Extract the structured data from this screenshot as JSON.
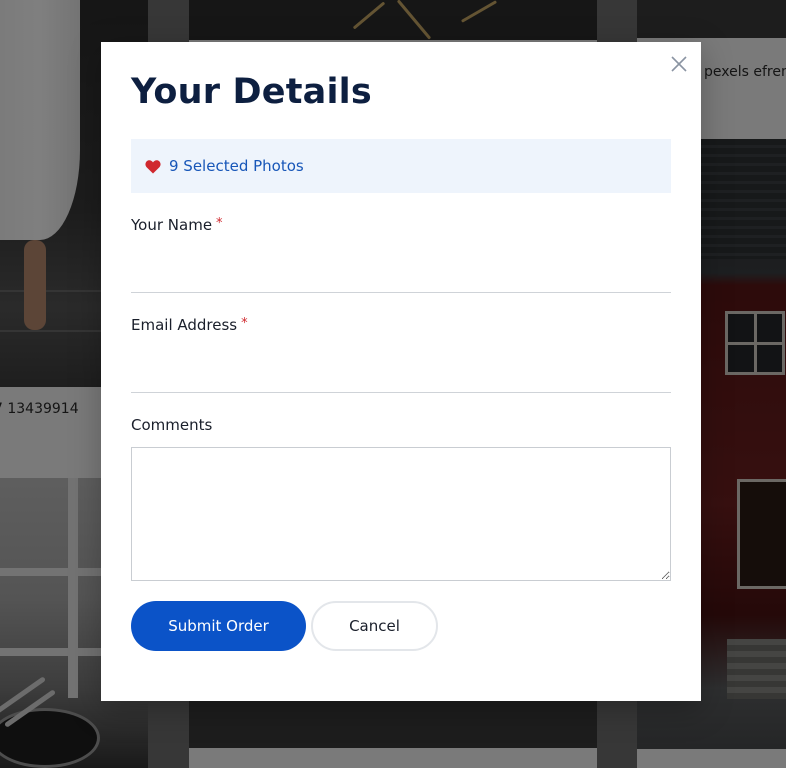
{
  "modal": {
    "title": "Your Details",
    "selected_photos": "9 Selected Photos",
    "name_label": "Your Name",
    "email_label": "Email Address",
    "comments_label": "Comments",
    "required_mark": "*",
    "name_value": "",
    "email_value": "",
    "comments_value": "",
    "submit_label": "Submit Order",
    "cancel_label": "Cancel"
  },
  "background": {
    "caption_left": "7 13439914",
    "caption_right": "pexels efren"
  },
  "icons": {
    "close": "close-icon",
    "heart": "heart-icon"
  },
  "colors": {
    "accent": "#0b53c8",
    "title": "#0d1f40",
    "highlight_bg": "#eef4fc",
    "heart": "#d0282e"
  }
}
